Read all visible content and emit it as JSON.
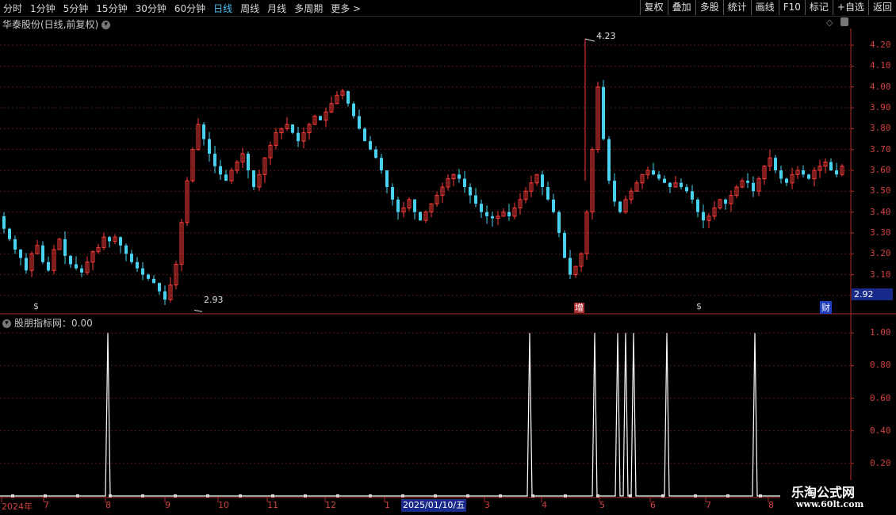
{
  "toolbar": {
    "periods": [
      "分时",
      "1分钟",
      "5分钟",
      "15分钟",
      "30分钟",
      "60分钟",
      "日线",
      "周线",
      "月线",
      "多周期",
      "更多 >"
    ],
    "active_period": "日线",
    "right_buttons": [
      "复权",
      "叠加",
      "多股",
      "统计",
      "画线",
      "F10",
      "标记",
      "+自选",
      "返回"
    ]
  },
  "main_pane": {
    "title": "华泰股份(日线,前复权)",
    "price_tag": "2.92",
    "high_label": "4.23",
    "low_label": "2.93",
    "events": [
      {
        "label": "$",
        "color": "#e03030"
      },
      {
        "label": "增",
        "color": "#e03030"
      },
      {
        "label": "$",
        "color": "#e03030"
      },
      {
        "label": "财",
        "color": "#4070ff"
      }
    ]
  },
  "indicator_pane": {
    "title": "股朋指标网：0.00"
  },
  "x_axis": {
    "labels": [
      "2024年",
      "7",
      "8",
      "9",
      "10",
      "11",
      "12",
      "1",
      "2025/01/10/五",
      "3",
      "4",
      "5",
      "6",
      "7",
      "8"
    ]
  },
  "watermark": {
    "line1": "乐淘公式网",
    "line2": "www.60lt.com"
  },
  "chart_data": [
    {
      "type": "candlestick",
      "title": "华泰股份(日线,前复权)",
      "y_ticks": [
        "4.20",
        "4.10",
        "4.00",
        "3.90",
        "3.80",
        "3.70",
        "3.60",
        "3.50",
        "3.40",
        "3.30",
        "3.20",
        "3.10",
        "3.00"
      ],
      "ylim": [
        2.92,
        4.28
      ],
      "annotations": {
        "max": 4.23,
        "min": 2.93
      },
      "close_path": [
        3.38,
        3.32,
        3.27,
        3.22,
        3.18,
        3.12,
        3.2,
        3.24,
        3.16,
        3.12,
        3.22,
        3.27,
        3.19,
        3.15,
        3.13,
        3.11,
        3.16,
        3.21,
        3.23,
        3.28,
        3.26,
        3.28,
        3.24,
        3.2,
        3.16,
        3.13,
        3.1,
        3.08,
        3.06,
        3.02,
        2.98,
        3.05,
        3.15,
        3.35,
        3.55,
        3.7,
        3.82,
        3.75,
        3.68,
        3.62,
        3.58,
        3.55,
        3.6,
        3.64,
        3.68,
        3.6,
        3.52,
        3.58,
        3.66,
        3.72,
        3.78,
        3.8,
        3.82,
        3.78,
        3.74,
        3.78,
        3.82,
        3.86,
        3.84,
        3.88,
        3.92,
        3.96,
        3.98,
        3.92,
        3.86,
        3.8,
        3.74,
        3.7,
        3.66,
        3.6,
        3.52,
        3.46,
        3.4,
        3.42,
        3.46,
        3.4,
        3.36,
        3.4,
        3.44,
        3.48,
        3.52,
        3.56,
        3.58,
        3.56,
        3.52,
        3.48,
        3.44,
        3.4,
        3.38,
        3.37,
        3.38,
        3.4,
        3.38,
        3.42,
        3.46,
        3.5,
        3.54,
        3.58,
        3.52,
        3.46,
        3.4,
        3.3,
        3.18,
        3.1,
        3.14,
        3.2,
        3.4,
        3.7,
        4.0,
        3.75,
        3.55,
        3.45,
        3.4,
        3.46,
        3.5,
        3.54,
        3.58,
        3.6,
        3.58,
        3.56,
        3.54,
        3.52,
        3.54,
        3.52,
        3.5,
        3.46,
        3.4,
        3.36,
        3.38,
        3.42,
        3.46,
        3.44,
        3.48,
        3.52,
        3.55,
        3.54,
        3.5,
        3.56,
        3.62,
        3.66,
        3.6,
        3.56,
        3.54,
        3.58,
        3.6,
        3.58,
        3.56,
        3.6,
        3.62,
        3.64,
        3.6,
        3.58,
        3.62,
        3.66,
        3.7,
        3.72
      ]
    },
    {
      "type": "line",
      "title": "股朋指标网：0.00",
      "y_ticks": [
        "1.00",
        "0.80",
        "0.60",
        "0.40",
        "0.20"
      ],
      "ylim": [
        0,
        1.05
      ],
      "spikes": [
        {
          "x": 136,
          "value": 1.0
        },
        {
          "x": 668,
          "value": 1.0
        },
        {
          "x": 750,
          "value": 1.0
        },
        {
          "x": 779,
          "value": 1.0
        },
        {
          "x": 789,
          "value": 1.0
        },
        {
          "x": 799,
          "value": 1.0
        },
        {
          "x": 841,
          "value": 1.0
        },
        {
          "x": 952,
          "value": 1.0
        }
      ],
      "values_when_zero": 0.0
    }
  ]
}
